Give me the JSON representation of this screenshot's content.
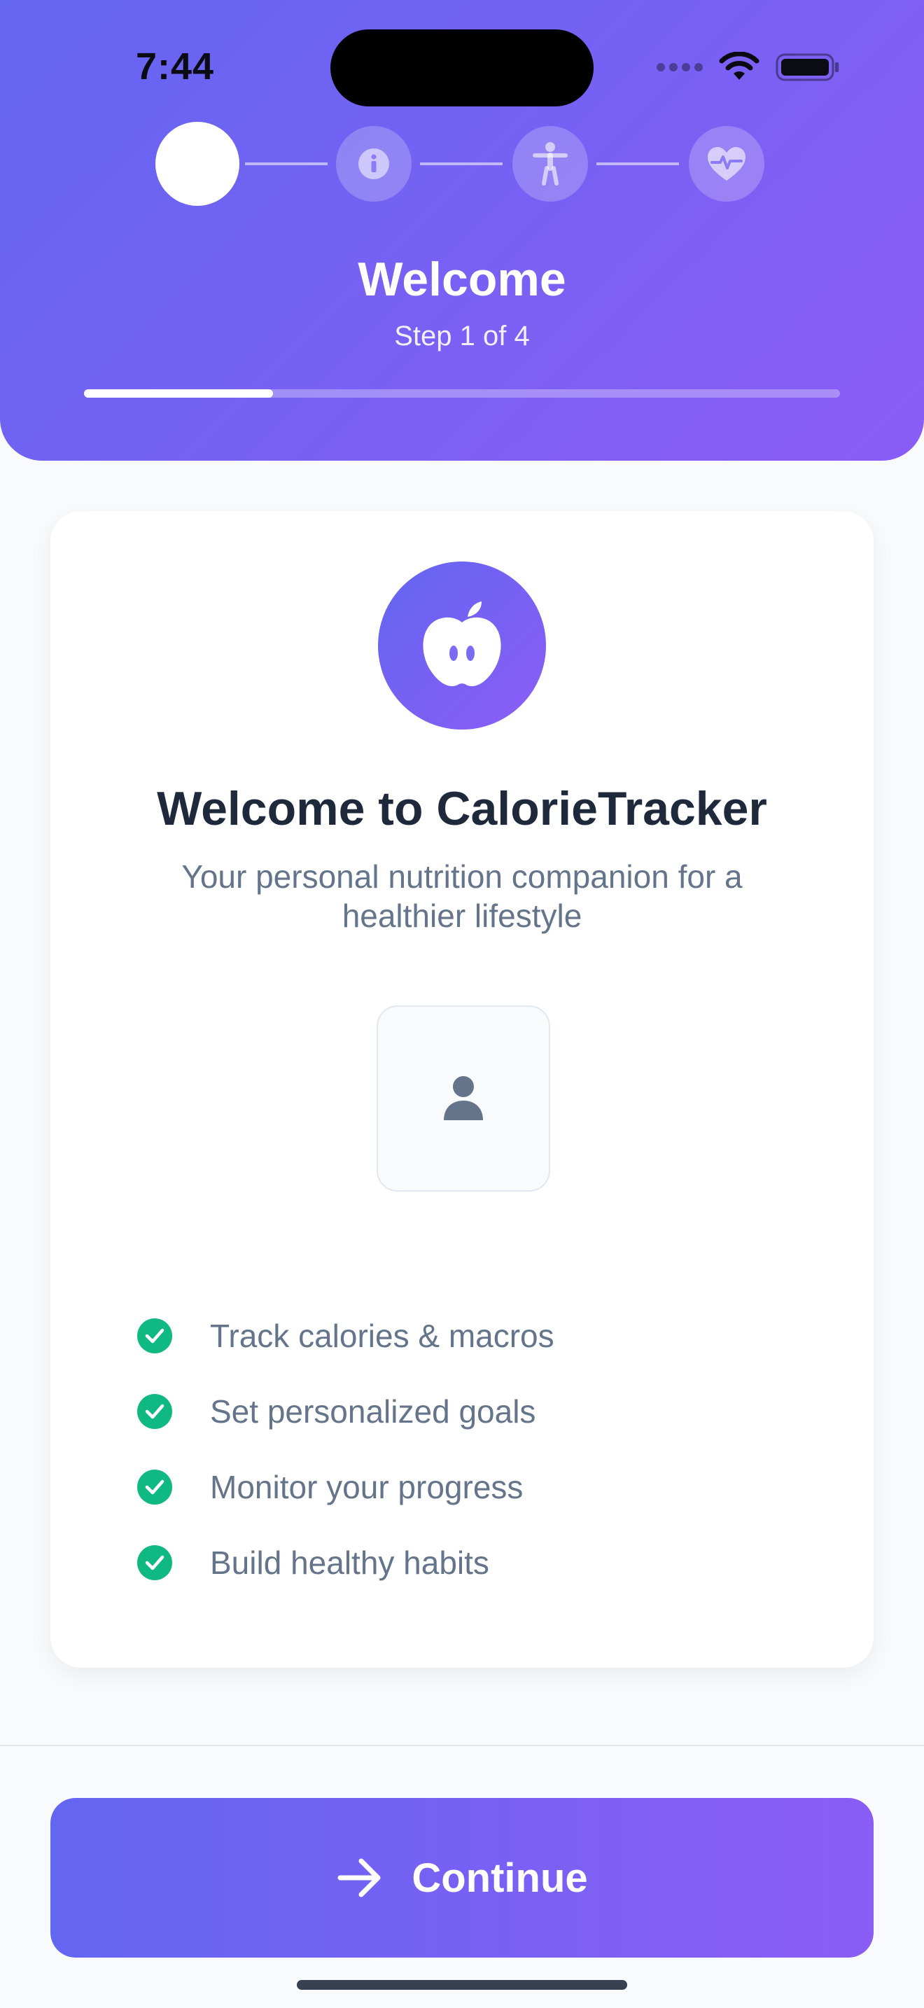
{
  "status_bar": {
    "time": "7:44",
    "icons": [
      "signal-dots-icon",
      "wifi-icon",
      "battery-icon"
    ]
  },
  "stepper": {
    "current_step": 1,
    "total_steps": 4,
    "steps": [
      {
        "icon": "filled-circle",
        "state": "active"
      },
      {
        "icon": "info-icon",
        "state": "upcoming"
      },
      {
        "icon": "person-icon",
        "state": "upcoming"
      },
      {
        "icon": "heart-pulse-icon",
        "state": "upcoming"
      }
    ]
  },
  "header": {
    "title": "Welcome",
    "subtitle": "Step 1 of 4",
    "progress_fraction": 0.25
  },
  "card": {
    "logo_icon": "apple-icon",
    "title": "Welcome to CalorieTracker",
    "description": "Your personal nutrition companion for a healthier lifestyle",
    "avatar_icon": "person-icon",
    "features": [
      "Track calories & macros",
      "Set personalized goals",
      "Monitor your progress",
      "Build healthy habits"
    ]
  },
  "footer": {
    "continue_label": "Continue",
    "continue_icon": "arrow-right-icon"
  },
  "colors": {
    "gradient_start": "#6366f1",
    "gradient_end": "#8b5cf6",
    "check_green": "#10b981",
    "title_text": "#1e293b",
    "muted_text": "#64748b"
  }
}
